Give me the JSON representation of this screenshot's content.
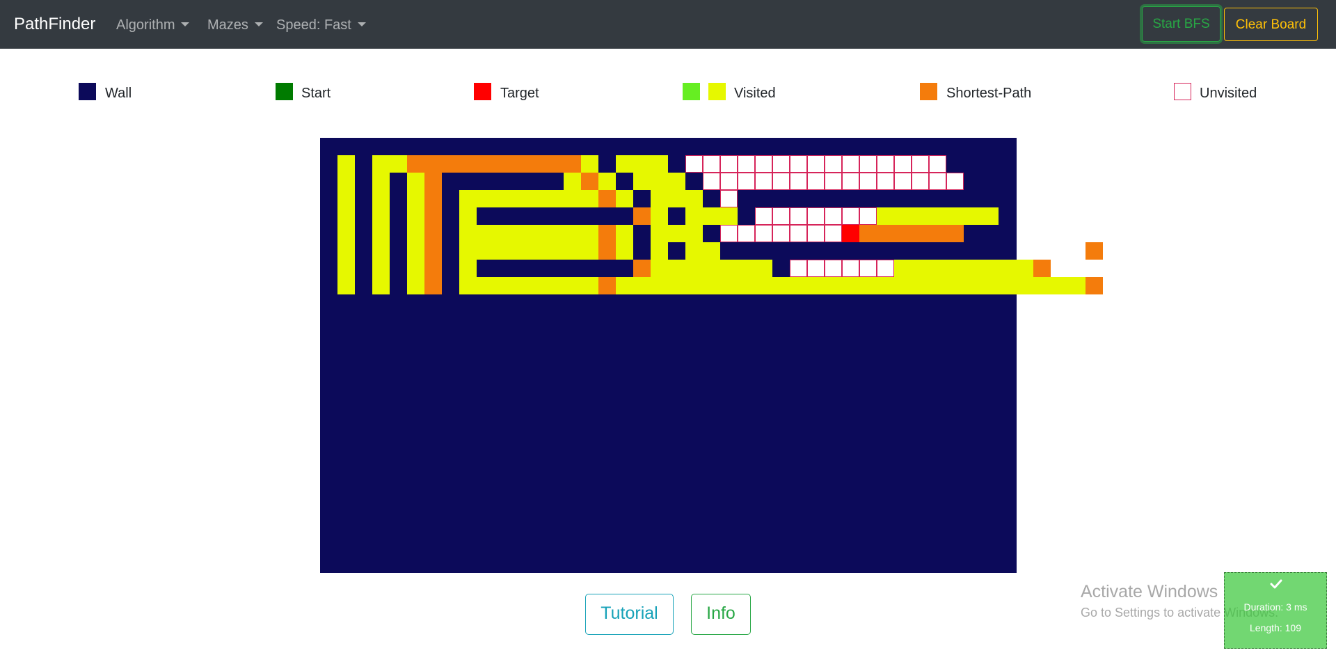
{
  "app": {
    "brand": "PathFinder",
    "nav": {
      "algorithm": "Algorithm",
      "mazes": "Mazes",
      "speed": "Speed: Fast"
    },
    "buttons": {
      "start": "Start BFS",
      "clear": "Clear Board"
    }
  },
  "legend": {
    "wall": "Wall",
    "start": "Start",
    "target": "Target",
    "visited": "Visited",
    "shortest_path": "Shortest-Path",
    "unvisited": "Unvisited"
  },
  "colors": {
    "wall": "#0c0a5a",
    "start": "#007b00",
    "target": "#ff0000",
    "visited_green": "#66ee22",
    "visited": "#e6f800",
    "path": "#f47c0c",
    "unvisited_border": "#d6245a",
    "navbar": "#343a40"
  },
  "maze": {
    "legend_codes": {
      "#": "wall",
      "V": "visited",
      "P": "shortest-path",
      "U": "unvisited",
      "S": "start",
      "T": "target"
    },
    "rows": [
      "V#VVPPPPPPPPPPV#VVV#UUUUUUUUUUUUUUU",
      "V#V#VP#######VPV#VVV#UUUUUUUUUUUUUUU",
      "V#V#VP#VVVVVVVVPV#VVV#U##############",
      "V#V#VP#V#########PV#VVV#UUUUUUUVVVVVVV",
      "V#V#VP#VVVVVVVVPV#VVV#UUUUUUUTPPPPPP",
      "V#V#VP#VVVVVVVVPV#V#VV#####################P",
      "V#V#VP#V#########PVVVVVVV#UUUUUUVVVVVVVVP",
      "V#V#VP#VVVVVVVVPVVVVVVVVVVVVVVVVVVVVVVVVVVVP"
    ]
  },
  "actions": {
    "tutorial": "Tutorial",
    "info": "Info"
  },
  "watermark": {
    "title": "Activate Windows",
    "subtitle": "Go to Settings to activate Windows."
  },
  "result": {
    "duration": "Duration: 3 ms",
    "length": "Length: 109"
  }
}
